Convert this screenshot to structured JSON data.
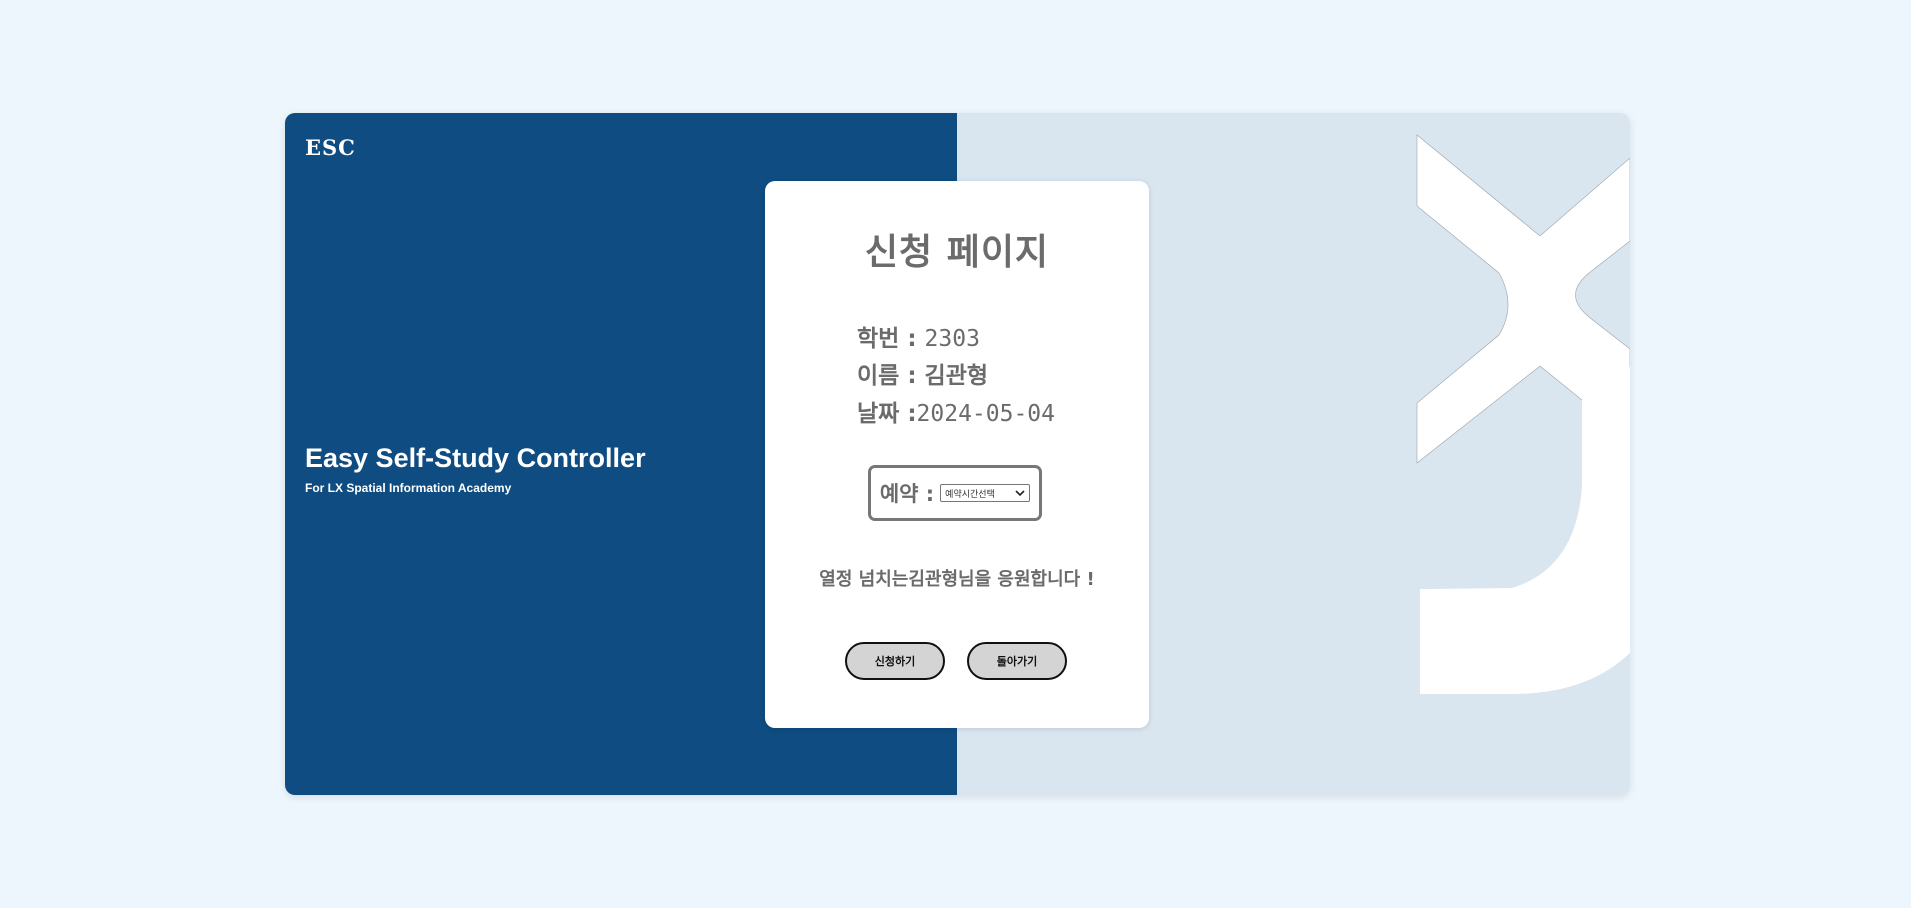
{
  "brand": {
    "logo": "ESC",
    "title": "Easy Self-Study Controller",
    "subtitle": "For LX Spatial Information Academy"
  },
  "card": {
    "title": "신청 페이지",
    "student_id_label": "학번 :",
    "student_id": "2303",
    "name_label": "이름 :",
    "name": "김관형",
    "date_label": "날짜 :",
    "date": "2024-05-04",
    "reserve_label": "예약 :",
    "reserve_select_value": "예약시간선택",
    "cheer_message": "열정 넘치는김관형님을 응원합니다 !",
    "apply_button": "신청하기",
    "back_button": "돌아가기"
  },
  "colors": {
    "page_bg": "#edf5fd",
    "left_panel": "#0f4c81",
    "right_panel": "#d9e5ef",
    "card_text": "#6b6b6b",
    "button_bg": "#d4d4d4"
  },
  "icons": {
    "select_arrow": "chevron-down-icon",
    "background_art": "lx-logo-art"
  }
}
